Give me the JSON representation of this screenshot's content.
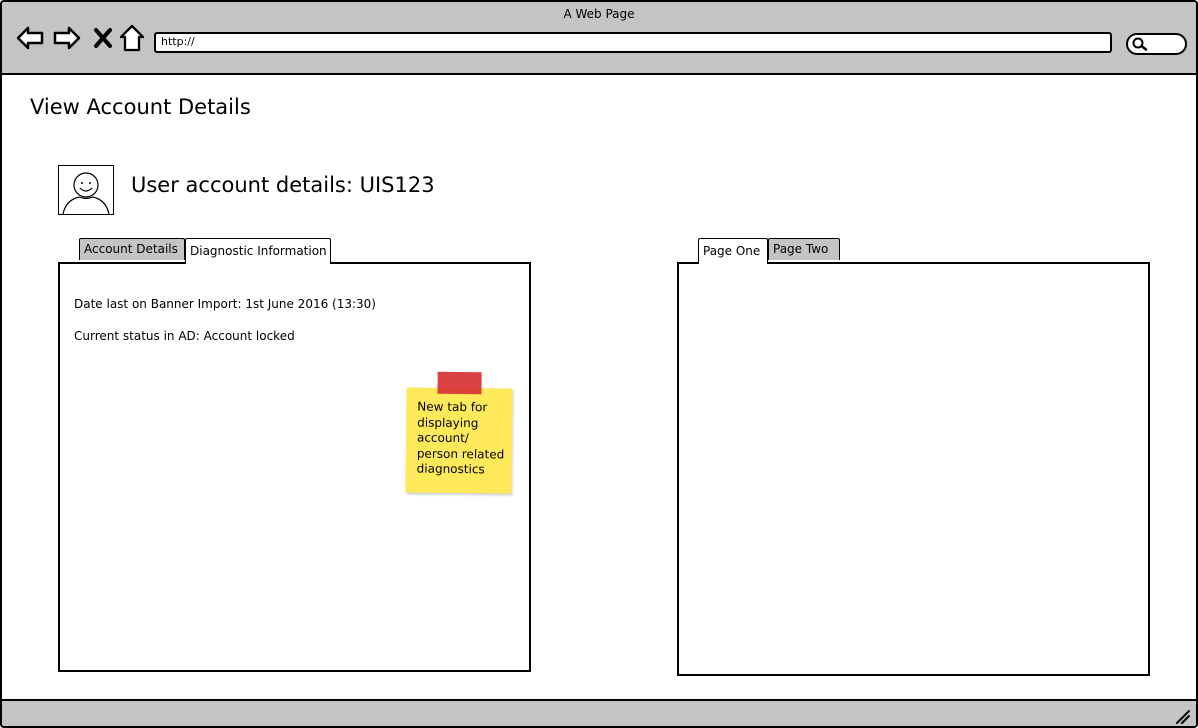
{
  "browser": {
    "title": "A Web Page",
    "url": "http://"
  },
  "page": {
    "heading": "View Account Details",
    "account_title": "User account details: UIS123"
  },
  "left_panel": {
    "tabs": [
      {
        "label": "Account Details",
        "active": false
      },
      {
        "label": "Diagnostic Information",
        "active": true
      }
    ],
    "lines": [
      "Date last on Banner Import: 1st June 2016 (13:30)",
      "Current status in AD: Account locked"
    ]
  },
  "right_panel": {
    "tabs": [
      {
        "label": "Page One",
        "active": true
      },
      {
        "label": "Page Two",
        "active": false
      }
    ]
  },
  "sticky_note": {
    "lines": [
      "New tab for",
      "displaying",
      "account/",
      "person related",
      "diagnostics"
    ],
    "color": "#fde95a",
    "tape_color": "#d9383a"
  },
  "icons": {
    "back": "back-arrow-icon",
    "forward": "forward-arrow-icon",
    "stop": "close-icon",
    "home": "home-icon",
    "search": "search-icon",
    "avatar": "user-avatar-icon",
    "resize": "resize-grip-icon"
  }
}
